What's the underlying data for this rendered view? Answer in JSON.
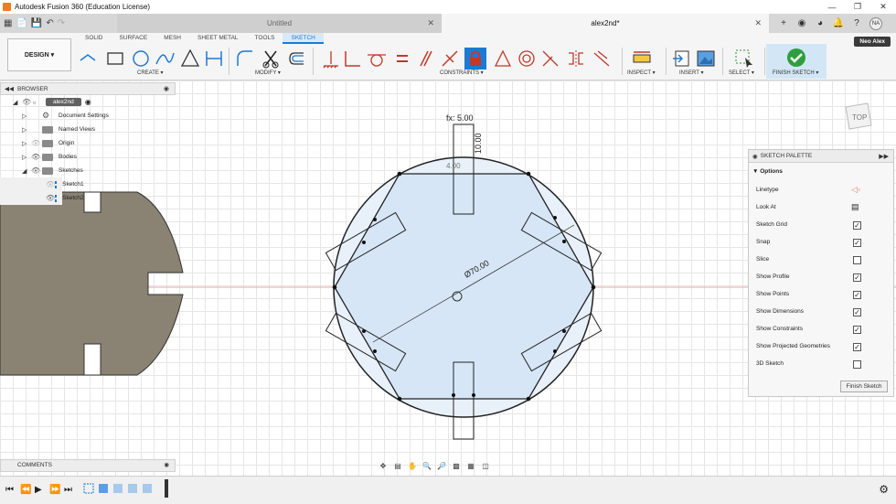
{
  "window": {
    "title": "Autodesk Fusion 360 (Education License)",
    "controls": [
      "—",
      "❐",
      "✕"
    ]
  },
  "tabs": {
    "inactive": "Untitled",
    "active": "alex2nd*"
  },
  "user": {
    "initials": "NA",
    "name": "Neo Alex"
  },
  "toolbar": {
    "workspace": "DESIGN ▾",
    "workspace_tabs": [
      "SOLID",
      "SURFACE",
      "MESH",
      "SHEET METAL",
      "TOOLS",
      "SKETCH"
    ],
    "active_tab": "SKETCH",
    "groups": {
      "create": "CREATE ▾",
      "modify": "MODIFY ▾",
      "constraints": "CONSTRAINTS ▾",
      "inspect": "INSPECT ▾",
      "insert": "INSERT ▾",
      "select": "SELECT ▾",
      "finish": "FINISH SKETCH ▾"
    }
  },
  "browser": {
    "title": "BROWSER",
    "items": [
      {
        "label": "alex2nd",
        "level": 0
      },
      {
        "label": "Document Settings",
        "level": 1
      },
      {
        "label": "Named Views",
        "level": 1
      },
      {
        "label": "Origin",
        "level": 1
      },
      {
        "label": "Bodies",
        "level": 1
      },
      {
        "label": "Sketches",
        "level": 1
      },
      {
        "label": "Sketch1",
        "level": 2
      },
      {
        "label": "Sketch2",
        "level": 2
      }
    ]
  },
  "palette": {
    "title": "SKETCH PALETTE",
    "section": "Options",
    "options": [
      {
        "label": "Linetype",
        "type": "icon"
      },
      {
        "label": "Look At",
        "type": "icon"
      },
      {
        "label": "Sketch Grid",
        "checked": true
      },
      {
        "label": "Snap",
        "checked": true
      },
      {
        "label": "Slice",
        "checked": false
      },
      {
        "label": "Show Profile",
        "checked": true
      },
      {
        "label": "Show Points",
        "checked": true
      },
      {
        "label": "Show Dimensions",
        "checked": true
      },
      {
        "label": "Show Constraints",
        "checked": true
      },
      {
        "label": "Show Projected Geometries",
        "checked": true
      },
      {
        "label": "3D Sketch",
        "checked": false
      }
    ],
    "finish_button": "Finish Sketch"
  },
  "sketch": {
    "dim_width": "fx: 5.00",
    "dim_height": "10.00",
    "dim_diameter": "Ø70.00",
    "dim_small": "4.00"
  },
  "comments": {
    "title": "COMMENTS"
  },
  "viewcube": {
    "label": "TOP"
  }
}
